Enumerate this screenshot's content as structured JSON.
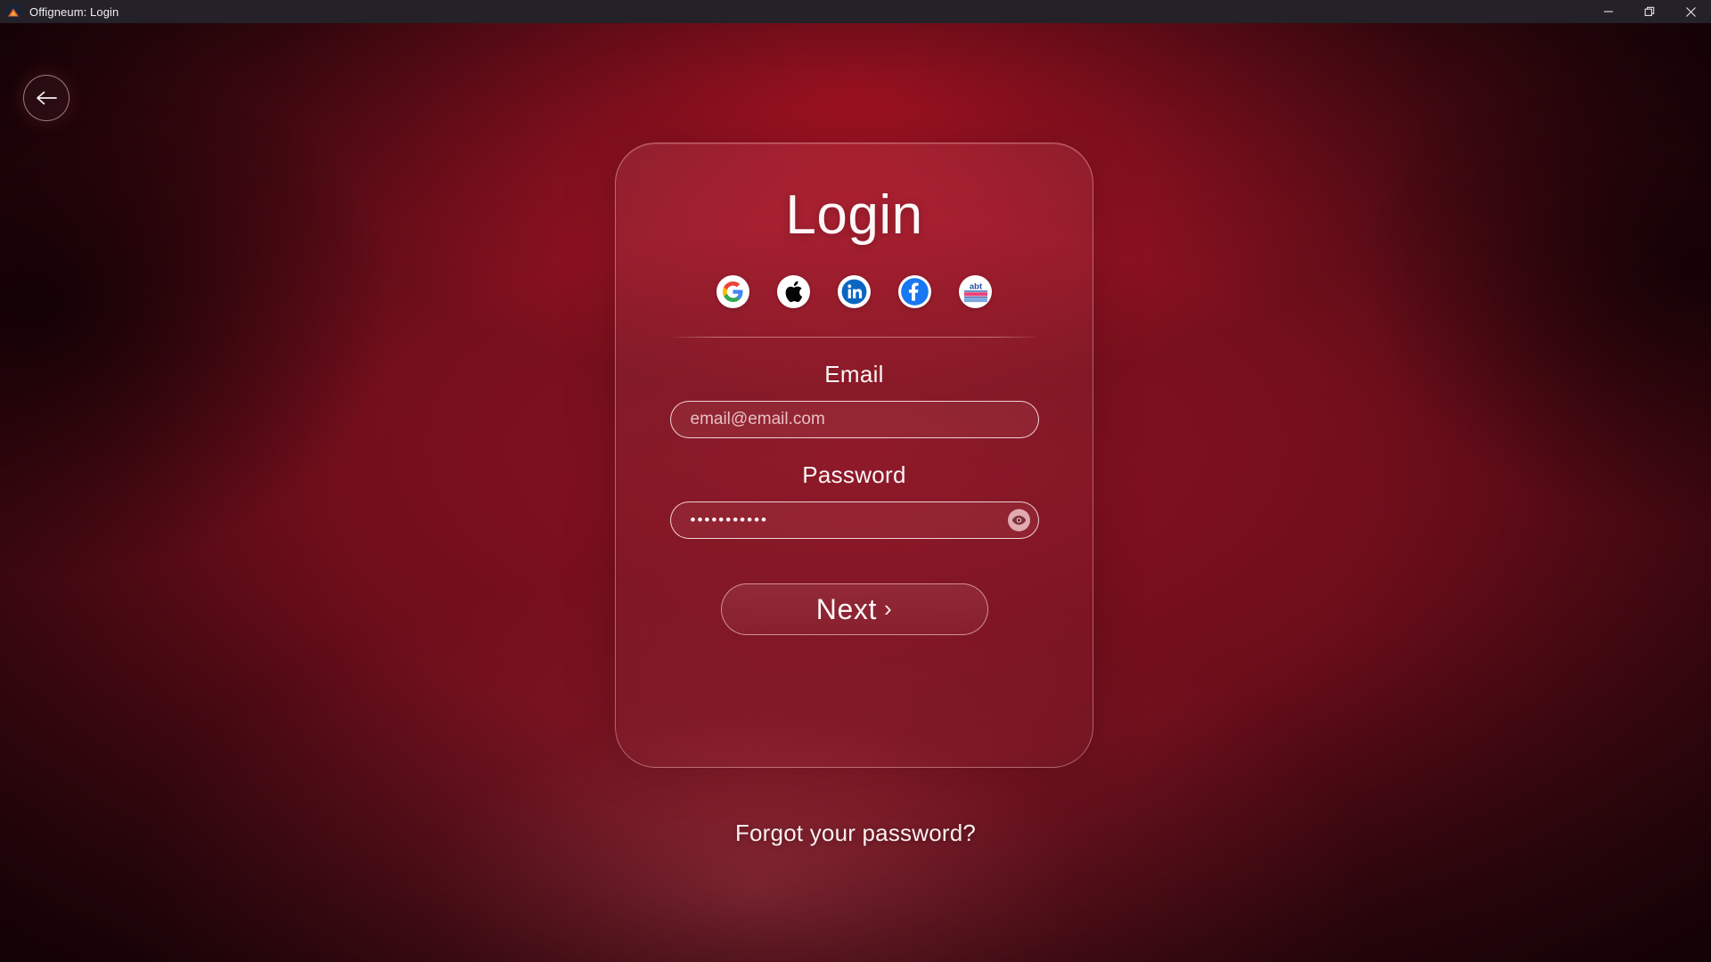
{
  "window": {
    "title": "Offigneum: Login",
    "app_icon": "mountain-logo-icon",
    "controls": {
      "minimize": "minimize-icon",
      "restore": "restore-icon",
      "close": "close-icon"
    }
  },
  "nav": {
    "back_label": "back-arrow-icon"
  },
  "card": {
    "title": "Login",
    "social_providers": [
      {
        "id": "google",
        "name": "Google",
        "icon": "google-icon"
      },
      {
        "id": "apple",
        "name": "Apple",
        "icon": "apple-icon"
      },
      {
        "id": "linkedin",
        "name": "LinkedIn",
        "icon": "linkedin-icon"
      },
      {
        "id": "facebook",
        "name": "Facebook",
        "icon": "facebook-icon"
      },
      {
        "id": "abt",
        "name": "abt",
        "icon": "abt-icon",
        "logo_text": "abt"
      }
    ],
    "email": {
      "label": "Email",
      "placeholder": "email@email.com",
      "value": ""
    },
    "password": {
      "label": "Password",
      "value": "•••••••••••",
      "toggle_icon": "eye-icon"
    },
    "submit": {
      "label": "Next",
      "chevron": "›"
    }
  },
  "links": {
    "forgot_password": "Forgot your password?"
  },
  "colors": {
    "titlebar_bg": "#242128",
    "titlebar_text": "#f0eff2",
    "background_center": "#c61629",
    "background_mid": "#8e1223",
    "background_edge": "#230409",
    "card_border": "#ffced4",
    "text_primary": "#fdf7f8",
    "google_blue": "#4285f4",
    "google_red": "#ea4335",
    "google_yellow": "#fbbc05",
    "google_green": "#34a853",
    "linkedin_blue": "#0a66c2",
    "facebook_blue": "#1877f2",
    "apple_black": "#050505",
    "abt_blue": "#1f4fa8",
    "abt_pink": "#e8447a"
  }
}
